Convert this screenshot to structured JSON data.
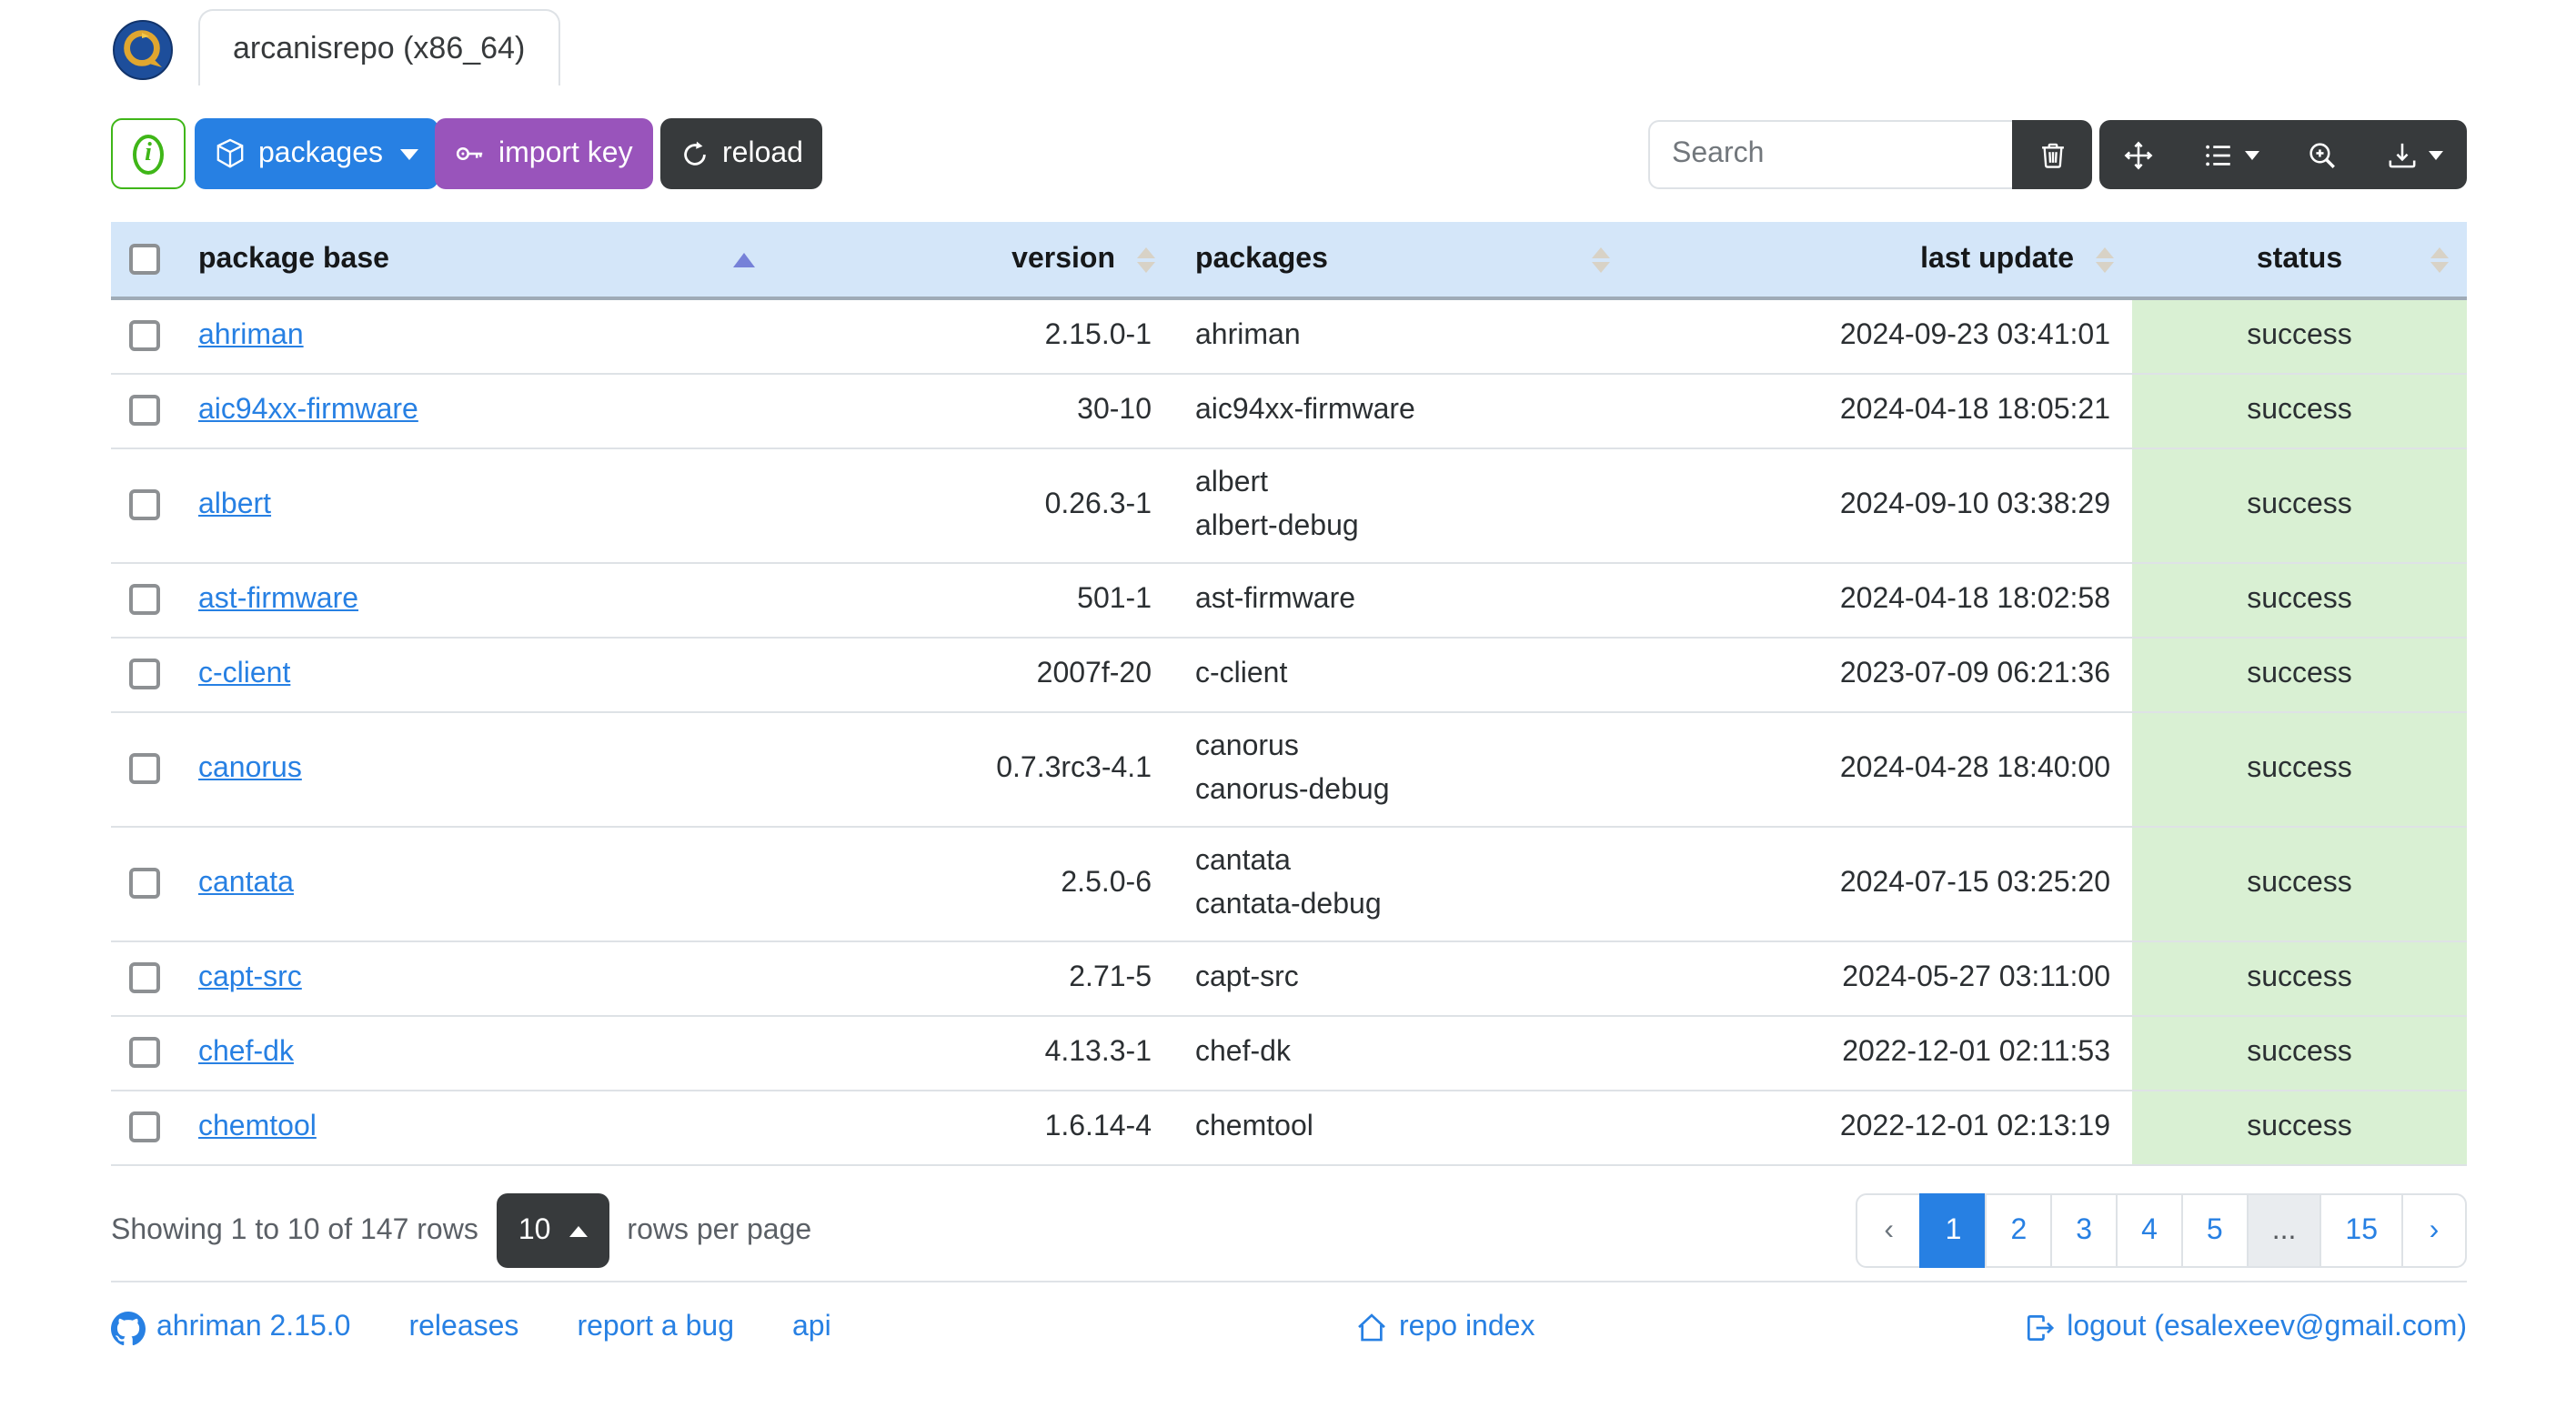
{
  "header": {
    "tab_label": "arcanisrepo (x86_64)",
    "logo": "repository-logo"
  },
  "toolbar": {
    "info_button_icon": "info-circle-icon",
    "packages_label": "packages",
    "import_key_label": "import key",
    "reload_label": "reload",
    "search_placeholder": "Search",
    "tool_icons": [
      "trash-icon",
      "arrows-move-icon",
      "list-columns-icon",
      "zoom-in-icon",
      "download-icon"
    ]
  },
  "table": {
    "columns": [
      {
        "label": "package base",
        "align": "left",
        "sort": "asc"
      },
      {
        "label": "version",
        "align": "right",
        "sort": "none"
      },
      {
        "label": "packages",
        "align": "left",
        "sort": "none"
      },
      {
        "label": "last update",
        "align": "right",
        "sort": "none"
      },
      {
        "label": "status",
        "align": "center",
        "sort": "none"
      }
    ],
    "rows": [
      {
        "base": "ahriman",
        "version": "2.15.0-1",
        "packages": [
          "ahriman"
        ],
        "last_update": "2024-09-23 03:41:01",
        "status": "success"
      },
      {
        "base": "aic94xx-firmware",
        "version": "30-10",
        "packages": [
          "aic94xx-firmware"
        ],
        "last_update": "2024-04-18 18:05:21",
        "status": "success"
      },
      {
        "base": "albert",
        "version": "0.26.3-1",
        "packages": [
          "albert",
          "albert-debug"
        ],
        "last_update": "2024-09-10 03:38:29",
        "status": "success"
      },
      {
        "base": "ast-firmware",
        "version": "501-1",
        "packages": [
          "ast-firmware"
        ],
        "last_update": "2024-04-18 18:02:58",
        "status": "success"
      },
      {
        "base": "c-client",
        "version": "2007f-20",
        "packages": [
          "c-client"
        ],
        "last_update": "2023-07-09 06:21:36",
        "status": "success"
      },
      {
        "base": "canorus",
        "version": "0.7.3rc3-4.1",
        "packages": [
          "canorus",
          "canorus-debug"
        ],
        "last_update": "2024-04-28 18:40:00",
        "status": "success"
      },
      {
        "base": "cantata",
        "version": "2.5.0-6",
        "packages": [
          "cantata",
          "cantata-debug"
        ],
        "last_update": "2024-07-15 03:25:20",
        "status": "success"
      },
      {
        "base": "capt-src",
        "version": "2.71-5",
        "packages": [
          "capt-src"
        ],
        "last_update": "2024-05-27 03:11:00",
        "status": "success"
      },
      {
        "base": "chef-dk",
        "version": "4.13.3-1",
        "packages": [
          "chef-dk"
        ],
        "last_update": "2022-12-01 02:11:53",
        "status": "success"
      },
      {
        "base": "chemtool",
        "version": "1.6.14-4",
        "packages": [
          "chemtool"
        ],
        "last_update": "2022-12-01 02:13:19",
        "status": "success"
      }
    ]
  },
  "pagination": {
    "summary": "Showing 1 to 10 of 147 rows",
    "page_size": "10",
    "suffix": "rows per page",
    "previous": "‹",
    "next": "›",
    "pages": [
      "1",
      "2",
      "3",
      "4",
      "5",
      "...",
      "15"
    ],
    "active_page": "1"
  },
  "footer": {
    "links": [
      {
        "label": "ahriman 2.15.0",
        "icon": "github-icon"
      },
      {
        "label": "releases"
      },
      {
        "label": "report a bug"
      },
      {
        "label": "api"
      }
    ],
    "repo_index_label": "repo index",
    "logout_label": "logout (esalexeev@gmail.com)"
  },
  "colors": {
    "primary": "#2780e3",
    "info_purple": "#9954bb",
    "success_green": "#3fb618",
    "dark": "#373a3c",
    "table_header_bg": "#d4e6f9",
    "status_success_bg": "#d9f0d3",
    "border": "#dee2e6",
    "sort_active": "#7681d8",
    "link": "#2780e3"
  }
}
